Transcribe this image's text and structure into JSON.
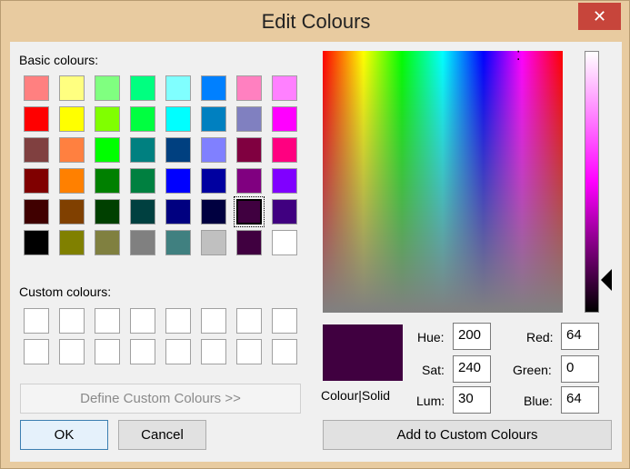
{
  "window": {
    "title": "Edit Colours",
    "close_label": "✕"
  },
  "labels": {
    "basic_colours": "Basic colours:",
    "custom_colours": "Custom colours:",
    "colour_solid": "Colour|Solid",
    "hue": "Hue:",
    "sat": "Sat:",
    "lum": "Lum:",
    "red": "Red:",
    "green": "Green:",
    "blue": "Blue:"
  },
  "values": {
    "hue": "200",
    "sat": "240",
    "lum": "30",
    "red": "64",
    "green": "0",
    "blue": "64"
  },
  "buttons": {
    "define_custom": "Define Custom Colours >>",
    "ok": "OK",
    "cancel": "Cancel",
    "add_to_custom": "Add to Custom Colours"
  },
  "basic_colors": [
    "#ff8080",
    "#ffff80",
    "#80ff80",
    "#00ff80",
    "#80ffff",
    "#0080ff",
    "#ff80c0",
    "#ff80ff",
    "#ff0000",
    "#ffff00",
    "#80ff00",
    "#00ff40",
    "#00ffff",
    "#0080c0",
    "#8080c0",
    "#ff00ff",
    "#804040",
    "#ff8040",
    "#00ff00",
    "#008080",
    "#004080",
    "#8080ff",
    "#800040",
    "#ff0080",
    "#800000",
    "#ff8000",
    "#008000",
    "#008040",
    "#0000ff",
    "#0000a0",
    "#800080",
    "#8000ff",
    "#400000",
    "#804000",
    "#004000",
    "#004040",
    "#000080",
    "#000040",
    "#400040",
    "#400080",
    "#000000",
    "#808000",
    "#808040",
    "#808080",
    "#408080",
    "#c0c0c0",
    "#400040",
    "#ffffff"
  ],
  "selected_index": 38,
  "preview_color": "#400040",
  "custom_colors": [
    "#ffffff",
    "#ffffff",
    "#ffffff",
    "#ffffff",
    "#ffffff",
    "#ffffff",
    "#ffffff",
    "#ffffff",
    "#ffffff",
    "#ffffff",
    "#ffffff",
    "#ffffff",
    "#ffffff",
    "#ffffff",
    "#ffffff",
    "#ffffff"
  ]
}
